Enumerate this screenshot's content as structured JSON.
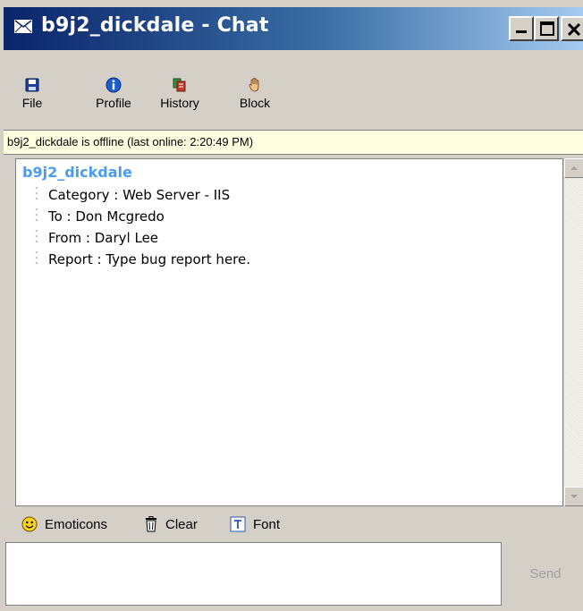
{
  "window": {
    "title": "b9j2_dickdale - Chat",
    "controls": {
      "minimize_icon": "minimize-icon",
      "maximize_icon": "maximize-icon",
      "close_icon": "close-icon"
    }
  },
  "toolbar": {
    "items": [
      {
        "label": "File",
        "icon": "save-icon"
      },
      {
        "label": "Profile",
        "icon": "info-icon"
      },
      {
        "label": "History",
        "icon": "history-icon"
      },
      {
        "label": "Block",
        "icon": "hand-icon"
      }
    ]
  },
  "status": {
    "text": "b9j2_dickdale is offline (last online: 2:20:49 PM)",
    "background": "#ffffe1"
  },
  "chat": {
    "sender": "b9j2_dickdale",
    "sender_color": "#4b9cf0",
    "lines": [
      "Category : Web Server - IIS",
      "To : Don Mcgredo",
      "From : Daryl Lee",
      "Report : Type bug report here."
    ]
  },
  "formatbar": {
    "emoticons_label": "Emoticons",
    "clear_label": "Clear",
    "font_label": "Font"
  },
  "compose": {
    "value": "",
    "send_label": "Send"
  }
}
